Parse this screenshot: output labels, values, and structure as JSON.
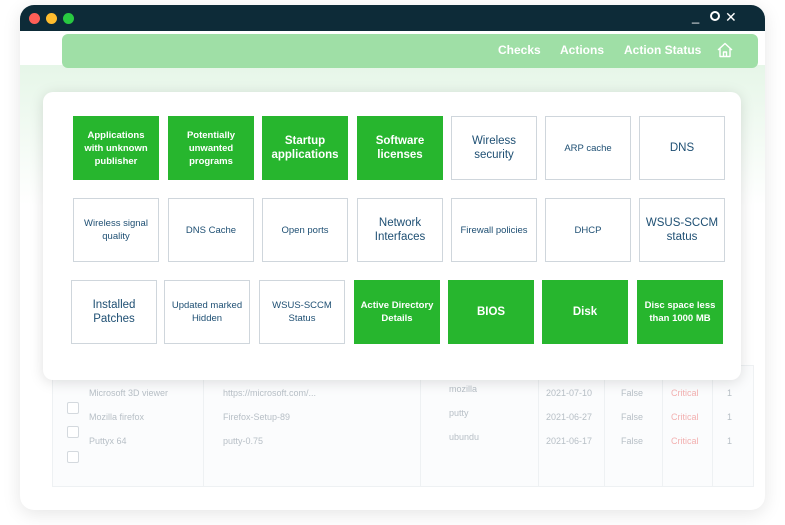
{
  "titlebar": {
    "controls": {
      "minimize": "_",
      "close": "✕"
    }
  },
  "nav": {
    "links": [
      "Checks",
      "Actions",
      "Action Status"
    ],
    "home_icon": "home-icon"
  },
  "colors": {
    "active_tile": "#27b62e",
    "titlebar": "#0d2b38",
    "navbar": "#9fdfa6",
    "tile_text": "#1e4f73"
  },
  "checks": [
    {
      "label": "Applications with unknown publisher",
      "active": true
    },
    {
      "label": "Potentially unwanted programs",
      "active": true
    },
    {
      "label": "Startup applications",
      "active": true
    },
    {
      "label": "Software licenses",
      "active": true
    },
    {
      "label": "Wireless security",
      "active": false
    },
    {
      "label": "ARP cache",
      "active": false
    },
    {
      "label": "DNS",
      "active": false
    },
    {
      "label": "Wireless signal quality",
      "active": false
    },
    {
      "label": "DNS Cache",
      "active": false
    },
    {
      "label": "Open ports",
      "active": false
    },
    {
      "label": "Network Interfaces",
      "active": false
    },
    {
      "label": "Firewall policies",
      "active": false
    },
    {
      "label": "DHCP",
      "active": false
    },
    {
      "label": "WSUS-SCCM status",
      "active": false
    },
    {
      "label": "Installed Patches",
      "active": false
    },
    {
      "label": "Updated marked Hidden",
      "active": false
    },
    {
      "label": "WSUS-SCCM Status",
      "active": false
    },
    {
      "label": "Active Directory Details",
      "active": true
    },
    {
      "label": "BIOS",
      "active": true
    },
    {
      "label": "Disk",
      "active": true
    },
    {
      "label": "Disc space less than 1000 MB",
      "active": true
    }
  ],
  "background_table": {
    "rows": [
      {
        "name": "Microsoft 3D viewer",
        "source": "https://microsoft.com/...",
        "user": "mozilla",
        "date": "2021-07-10",
        "flag": "False",
        "severity": "Critical",
        "count": "1"
      },
      {
        "name": "Mozilla firefox",
        "source": "Firefox-Setup-89",
        "user": "putty",
        "date": "2021-06-27",
        "flag": "False",
        "severity": "Critical",
        "count": "1"
      },
      {
        "name": "Puttyx 64",
        "source": "putty-0.75",
        "user": "ubundu",
        "date": "2021-06-17",
        "flag": "False",
        "severity": "Critical",
        "count": "1"
      }
    ]
  }
}
